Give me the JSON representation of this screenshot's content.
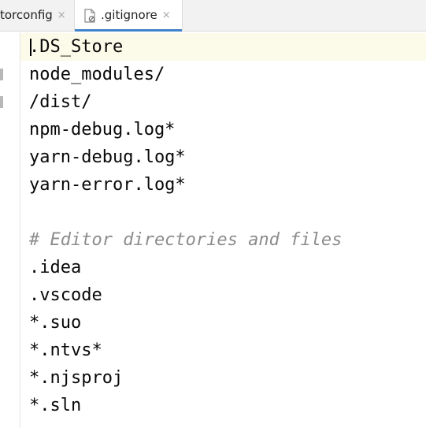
{
  "tabs": [
    {
      "label": "torconfig",
      "close": "×"
    },
    {
      "label": ".gitignore",
      "close": "×",
      "active": true
    }
  ],
  "icons": {
    "file": "gitignore-file-icon",
    "close": "close-icon"
  },
  "colors": {
    "tab_underline": "#4083c9",
    "comment": "#8c8c8c",
    "current_line": "#fcfae8",
    "text": "#080808"
  },
  "editor": {
    "lines": [
      ".DS_Store",
      "node_modules/",
      "/dist/",
      "npm-debug.log*",
      "yarn-debug.log*",
      "yarn-error.log*",
      "",
      "# Editor directories and files",
      ".idea",
      ".vscode",
      "*.suo",
      "*.ntvs*",
      "*.njsproj",
      "*.sln"
    ]
  }
}
